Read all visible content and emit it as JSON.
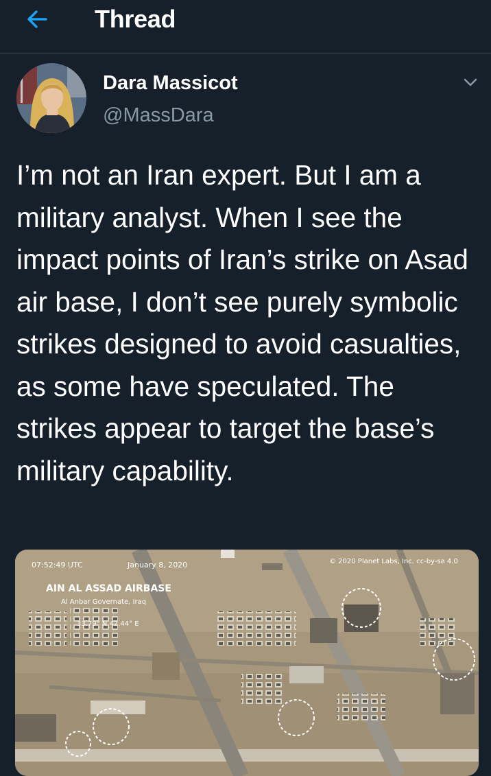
{
  "header": {
    "title": "Thread"
  },
  "tweet": {
    "author": {
      "display_name": "Dara Massicot",
      "handle": "@MassDara"
    },
    "text": "I’m not an Iran expert. But I am a military analyst. When I see the impact points of Iran’s strike on Asad air base, I don’t see purely symbolic strikes designed to avoid casualties, as some have speculated. The strikes appear to target the base’s military capability.",
    "media": {
      "timestamp": "07:52:49 UTC",
      "date": "January 8, 2020",
      "credit": "© 2020 Planet Labs, Inc. cc-by-sa 4.0",
      "location_title": "AIN AL ASSAD AIRBASE",
      "location_subtitle": "Al Anbar Governate, Iraq",
      "coordinates": "33.79° N 42.44° E"
    }
  },
  "colors": {
    "background": "#15202b",
    "accent": "#1da1f2",
    "secondary_text": "#8899a6",
    "divider": "#38444d"
  },
  "icons": {
    "back": "back-arrow-icon",
    "more": "chevron-down-icon"
  }
}
